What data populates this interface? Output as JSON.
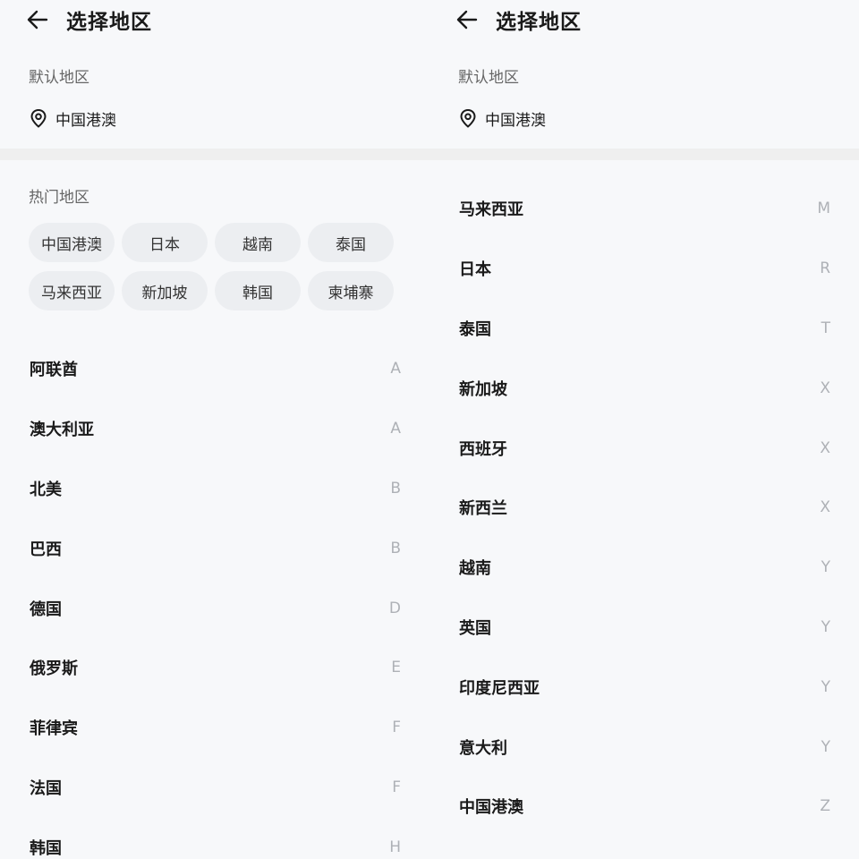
{
  "left": {
    "title": "选择地区",
    "default_label": "默认地区",
    "default_region": "中国港澳",
    "hot_label": "热门地区",
    "hot_regions": [
      "中国港澳",
      "日本",
      "越南",
      "泰国",
      "马来西亚",
      "新加坡",
      "韩国",
      "柬埔寨"
    ],
    "regions": [
      {
        "name": "阿联酋",
        "letter": "A"
      },
      {
        "name": "澳大利亚",
        "letter": "A"
      },
      {
        "name": "北美",
        "letter": "B"
      },
      {
        "name": "巴西",
        "letter": "B"
      },
      {
        "name": "德国",
        "letter": "D"
      },
      {
        "name": "俄罗斯",
        "letter": "E"
      },
      {
        "name": "菲律宾",
        "letter": "F"
      },
      {
        "name": "法国",
        "letter": "F"
      },
      {
        "name": "韩国",
        "letter": "H"
      }
    ]
  },
  "right": {
    "title": "选择地区",
    "default_label": "默认地区",
    "default_region": "中国港澳",
    "regions": [
      {
        "name": "马来西亚",
        "letter": "M"
      },
      {
        "name": "日本",
        "letter": "R"
      },
      {
        "name": "泰国",
        "letter": "T"
      },
      {
        "name": "新加坡",
        "letter": "X"
      },
      {
        "name": "西班牙",
        "letter": "X"
      },
      {
        "name": "新西兰",
        "letter": "X"
      },
      {
        "name": "越南",
        "letter": "Y"
      },
      {
        "name": "英国",
        "letter": "Y"
      },
      {
        "name": "印度尼西亚",
        "letter": "Y"
      },
      {
        "name": "意大利",
        "letter": "Y"
      },
      {
        "name": "中国港澳",
        "letter": "Z"
      }
    ]
  },
  "icons": {
    "back": "arrow-left-icon",
    "location": "location-pin-icon"
  },
  "colors": {
    "background": "#f7f8fa",
    "chip": "#eceef1",
    "text": "#1a1a1a",
    "muted": "#666666",
    "index_letter": "#aeb1b6"
  }
}
